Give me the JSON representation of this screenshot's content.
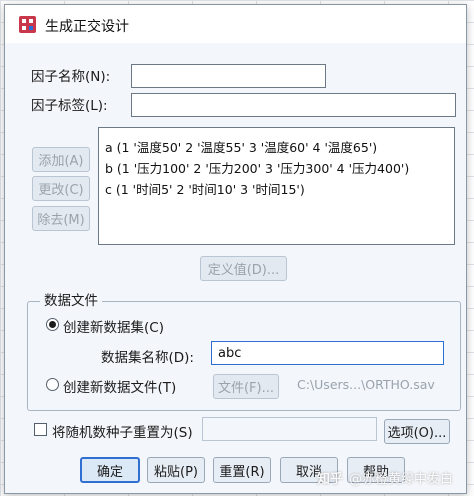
{
  "window": {
    "title": "生成正交设计"
  },
  "factor_name": {
    "label": "因子名称(N):",
    "value": ""
  },
  "factor_label": {
    "label": "因子标签(L):",
    "value": ""
  },
  "factors": [
    "a (1 '温度50' 2 '温度55' 3 '温度60' 4 '温度65')",
    "b (1 '压力100' 2 '压力200' 3 '压力300' 4 '压力400')",
    "c (1 '时间5' 2 '时间10' 3 '时间15')"
  ],
  "buttons": {
    "add": "添加(A)",
    "change": "更改(C)",
    "remove": "除去(M)",
    "define_values": "定义值(D)...",
    "file": "文件(F)...",
    "options": "选项(O)...",
    "ok": "确定",
    "paste": "粘贴(P)",
    "reset": "重置(R)",
    "cancel": "取消",
    "help": "帮助"
  },
  "data_file": {
    "group_title": "数据文件",
    "create_dataset": "创建新数据集(C)",
    "dataset_name_label": "数据集名称(D):",
    "dataset_name_value": "abc",
    "create_datafile": "创建新数据文件(T)",
    "file_path": "C:\\Users...\\ORTHO.sav"
  },
  "random_seed": {
    "label": "将随机数种子重置为(S)",
    "value": ""
  },
  "watermark": {
    "logo": "知乎",
    "text": "@赤橙黄绿中发白"
  }
}
